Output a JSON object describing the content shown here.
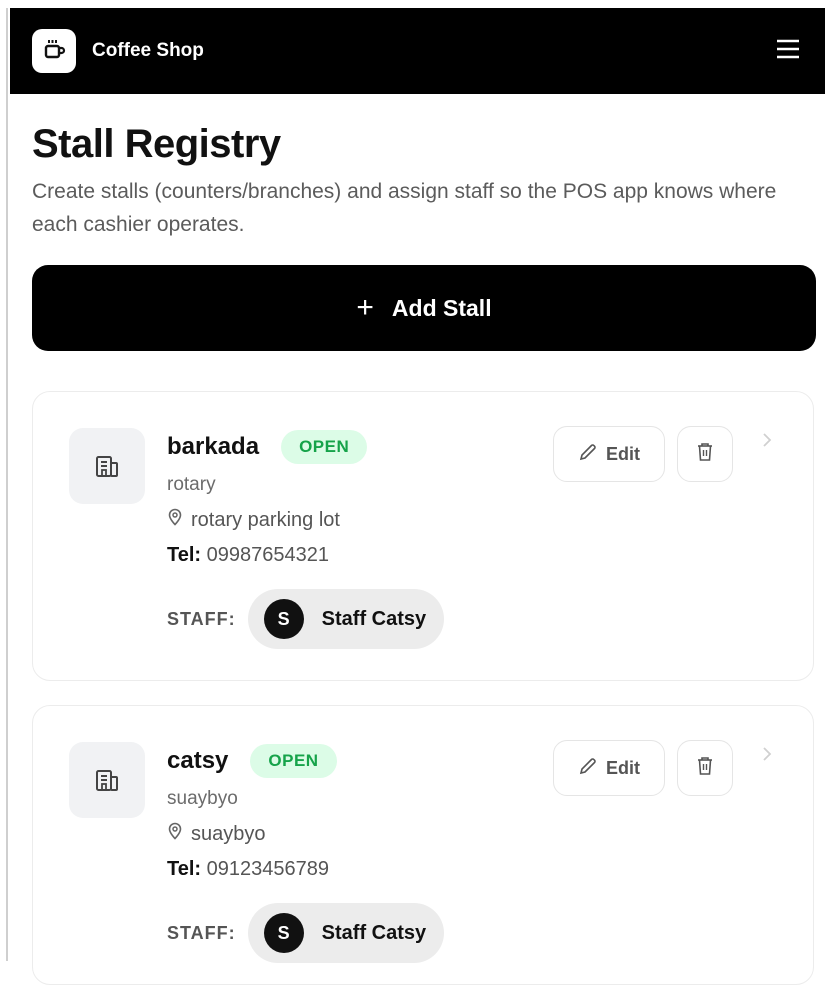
{
  "app": {
    "title": "Coffee Shop",
    "menu_icon": "hamburger-icon",
    "logo_icon": "coffee-cup-icon"
  },
  "page": {
    "title": "Stall Registry",
    "description": "Create stalls (counters/branches) and assign staff so the POS app knows where each cashier operates."
  },
  "actions": {
    "add_plus": "+",
    "add_label": "Add Stall"
  },
  "labels": {
    "tel": "Tel:",
    "staff": "STAFF:",
    "edit": "Edit"
  },
  "colors": {
    "accent": "#000000",
    "open_badge_bg": "#dcfce7",
    "open_badge_text": "#16a34a"
  },
  "stalls": [
    {
      "name": "barkada",
      "status": "OPEN",
      "subtitle": "rotary",
      "location": "rotary parking lot",
      "tel": "09987654321",
      "staff": [
        {
          "initial": "S",
          "name": "Staff Catsy"
        }
      ]
    },
    {
      "name": "catsy",
      "status": "OPEN",
      "subtitle": "suaybyo",
      "location": "suaybyo",
      "tel": "09123456789",
      "staff": [
        {
          "initial": "S",
          "name": "Staff Catsy"
        }
      ]
    }
  ]
}
